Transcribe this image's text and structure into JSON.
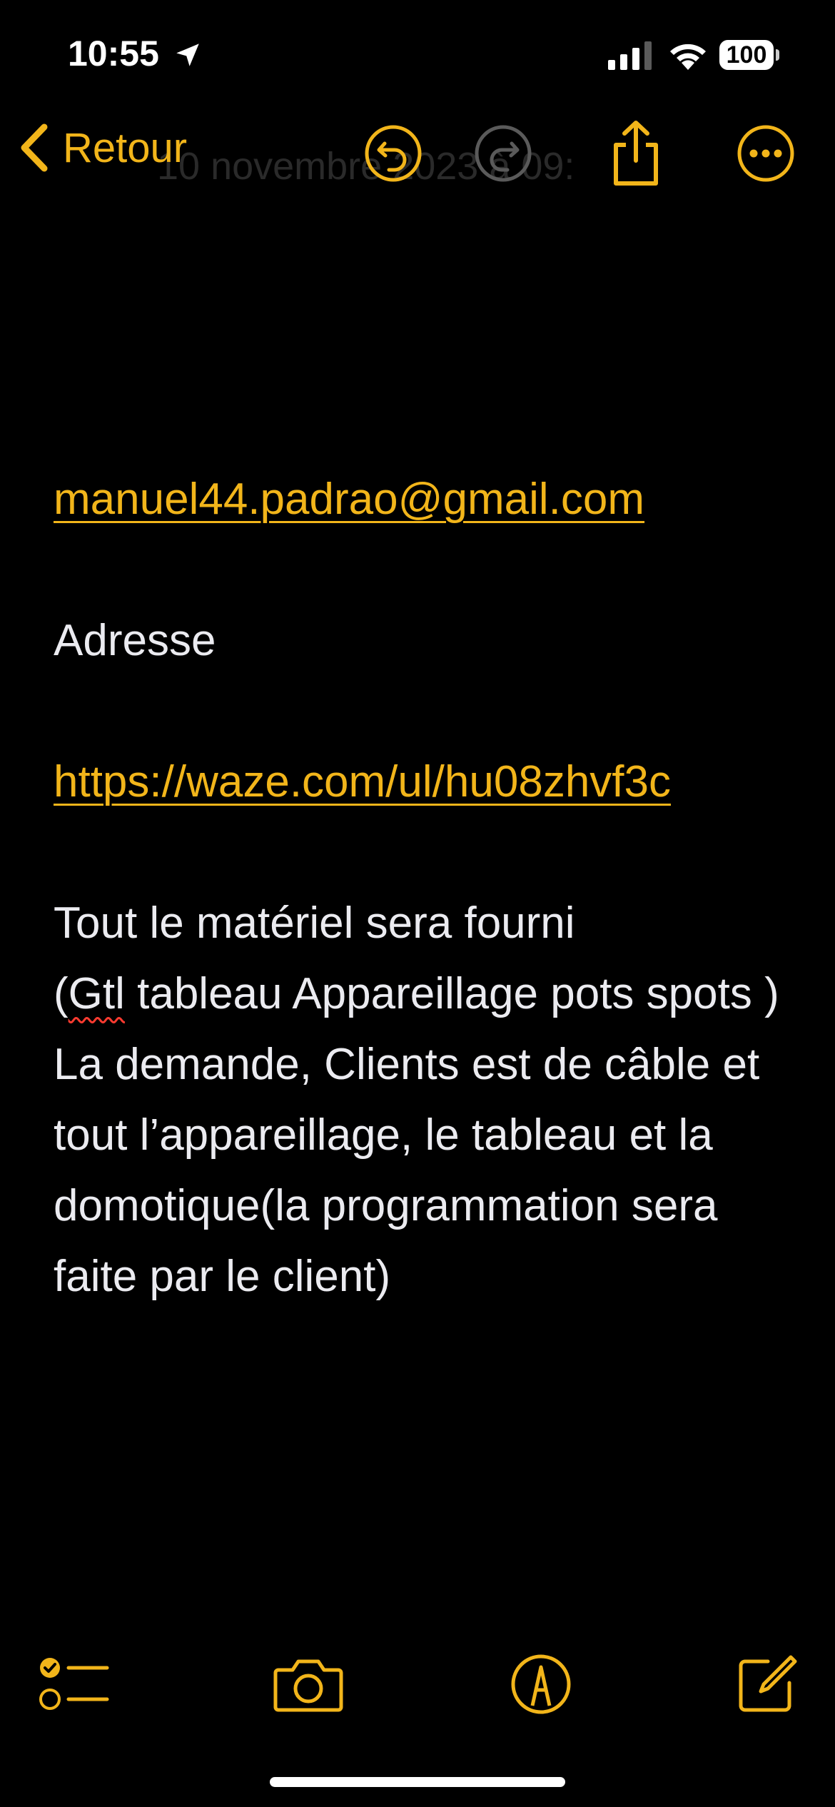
{
  "status_bar": {
    "time": "10:55",
    "battery_level": "100"
  },
  "nav": {
    "back_label": "Retour",
    "ghost_date": "10 novembre 2023 à 09:"
  },
  "note": {
    "email": "manuel44.padrao@gmail.com",
    "address_label": "Adresse",
    "waze_link": "https://waze.com/ul/hu08zhvf3c",
    "line1": "Tout le matériel sera fourni",
    "line2_prefix": "(",
    "line2_spell": "Gtl",
    "line2_rest": " tableau Appareillage pots spots )",
    "line3": "La demande, Clients est de câble et tout l’appareillage, le tableau et la domotique(la programmation sera faite par le client)"
  },
  "colors": {
    "accent": "#F2B51A",
    "background": "#000000",
    "text": "#EBEBF0"
  },
  "icons": {
    "undo": "undo-icon",
    "redo": "redo-icon",
    "share": "share-icon",
    "more": "more-icon",
    "checklist": "checklist-icon",
    "camera": "camera-icon",
    "markup": "markup-icon",
    "compose": "compose-icon"
  }
}
